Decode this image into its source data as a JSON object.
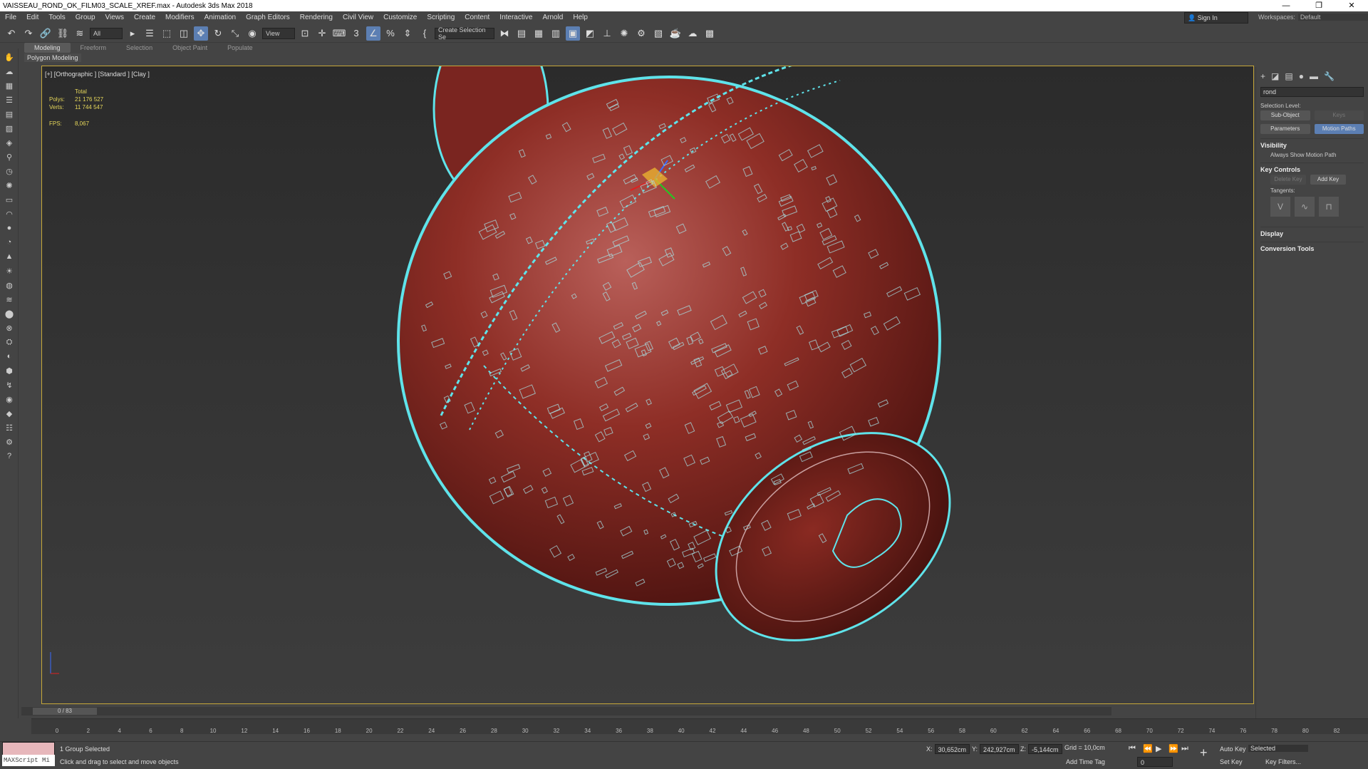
{
  "titlebar": {
    "title": "VAISSEAU_ROND_OK_FILM03_SCALE_XREF.max - Autodesk 3ds Max 2018",
    "min": "—",
    "max": "❐",
    "close": "✕"
  },
  "menu": [
    "File",
    "Edit",
    "Tools",
    "Group",
    "Views",
    "Create",
    "Modifiers",
    "Animation",
    "Graph Editors",
    "Rendering",
    "Civil View",
    "Customize",
    "Scripting",
    "Content",
    "Interactive",
    "Arnold",
    "Help"
  ],
  "signin": "Sign In",
  "workspaces": {
    "label": "Workspaces:",
    "value": "Default"
  },
  "toolbar": {
    "filter": "All",
    "view": "View",
    "selection_set": "Create Selection Se"
  },
  "ribbon": {
    "tabs": [
      "Modeling",
      "Freeform",
      "Selection",
      "Object Paint",
      "Populate"
    ],
    "sub": "Polygon Modeling"
  },
  "viewport": {
    "label": "[+] [Orthographic ] [Standard ] [Clay ]",
    "stats": {
      "total": "Total",
      "polys_label": "Polys:",
      "polys": "21 176 527",
      "verts_label": "Verts:",
      "verts": "11 744 547",
      "fps_label": "FPS:",
      "fps": "8,067"
    }
  },
  "panel": {
    "object_name": "rond",
    "selection_level": "Selection Level:",
    "sub_object": "Sub-Object",
    "keys": "Keys",
    "parameters": "Parameters",
    "motion_paths": "Motion Paths",
    "visibility": "Visibility",
    "always_show": "Always Show Motion Path",
    "key_controls": "Key Controls",
    "delete_key": "Delete Key",
    "add_key": "Add Key",
    "tangents": "Tangents:",
    "display": "Display",
    "conversion": "Conversion Tools"
  },
  "time": {
    "slider": "0 / 83",
    "ticks": [
      "0",
      "2",
      "4",
      "6",
      "8",
      "10",
      "12",
      "14",
      "16",
      "18",
      "20",
      "22",
      "24",
      "26",
      "28",
      "30",
      "32",
      "34",
      "36",
      "38",
      "40",
      "42",
      "44",
      "46",
      "48",
      "50",
      "52",
      "54",
      "56",
      "58",
      "60",
      "62",
      "64",
      "66",
      "68",
      "70",
      "72",
      "74",
      "76",
      "78",
      "80",
      "82"
    ]
  },
  "status": {
    "maxscript": "MAXScript Mi",
    "line1": "1 Group Selected",
    "line2": "Click and drag to select and move objects",
    "x_label": "X:",
    "x": "30,652cm",
    "y_label": "Y:",
    "y": "242,927cm",
    "z_label": "Z:",
    "z": "-5,144cm",
    "grid": "Grid = 10,0cm",
    "add_time_tag": "Add Time Tag",
    "auto_key": "Auto Key",
    "selected": "Selected",
    "set_key": "Set Key",
    "key_filters": "Key Filters...",
    "frame": "0"
  }
}
